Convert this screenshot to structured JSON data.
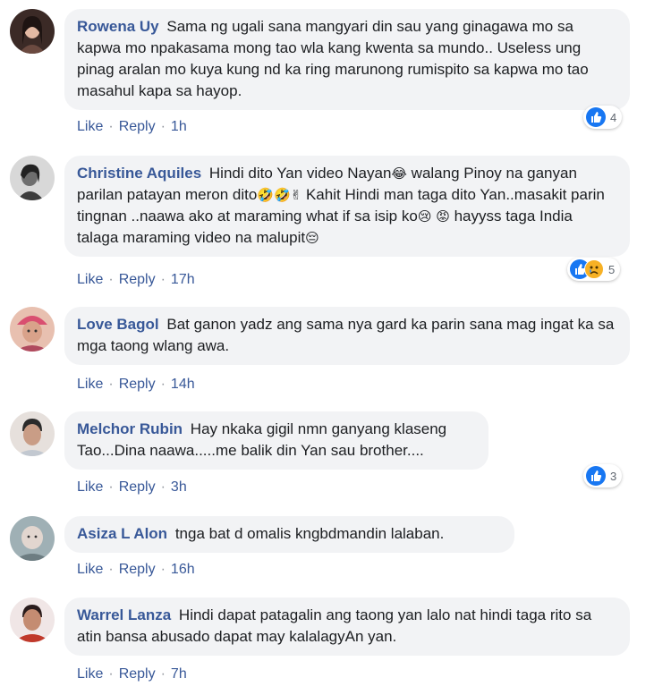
{
  "comments": [
    {
      "name": "Rowena Uy",
      "text": "Sama ng ugali sana mangyari din sau yang ginagawa mo sa kapwa mo npakasama mong tao wla kang kwenta sa mundo.. Useless ung pinag aralan mo kuya kung nd ka ring marunong rumispito sa kapwa mo tao masahul kapa sa hayop.",
      "like": "Like",
      "reply": "Reply",
      "time": "1h",
      "reactions": "4",
      "avatar_color": "#5a3d35"
    },
    {
      "name": "Christine Aquiles",
      "text1": "Hindi dito Yan video Nayan",
      "text2": " walang Pinoy na ganyan parilan patayan meron dito",
      "text3": " Kahit Hindi man taga dito Yan..masakit parin tingnan ..naawa ako at maraming what if sa isip ko",
      "text4": " hayyss taga India talaga maraming video na malupit",
      "like": "Like",
      "reply": "Reply",
      "time": "17h",
      "reactions": "5",
      "avatar_color": "#7a7a7a"
    },
    {
      "name": "Love Bagol",
      "text": "Bat ganon yadz ang sama nya gard ka parin sana mag ingat ka sa mga taong wlang awa.",
      "like": "Like",
      "reply": "Reply",
      "time": "14h",
      "avatar_color": "#c98a7a"
    },
    {
      "name": "Melchor Rubin",
      "text": "Hay nkaka gigil nmn ganyang klaseng Tao...Dina naawa.....me balik din Yan sau brother....",
      "like": "Like",
      "reply": "Reply",
      "time": "3h",
      "reactions": "3",
      "avatar_color": "#b59a8c"
    },
    {
      "name": "Asiza L Alon",
      "text": "tnga bat d omalis kngbdmandin lalaban.",
      "like": "Like",
      "reply": "Reply",
      "time": "16h",
      "avatar_color": "#8a9aa0"
    },
    {
      "name": "Warrel Lanza",
      "text": "Hindi dapat patagalin ang taong yan lalo nat hindi taga rito sa atin bansa abusado dapat may kalalagyAn yan.",
      "like": "Like",
      "reply": "Reply",
      "time": "7h",
      "avatar_color": "#c0392b"
    }
  ],
  "separator": "·",
  "emoji": {
    "laugh_cry": "😂",
    "rofl": "🤣",
    "victory": "✌",
    "crying": "😢",
    "angry": "😡",
    "pensive": "😔"
  },
  "colors": {
    "name": "#385898",
    "bubble": "#f2f3f5",
    "like_blue": "#1877f2",
    "sad_yellow": "#f7b125"
  }
}
